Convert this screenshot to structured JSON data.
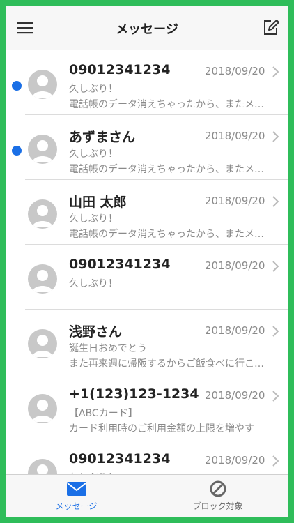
{
  "header": {
    "title": "メッセージ",
    "menu_icon": "hamburger-menu-icon",
    "compose_icon": "compose-icon"
  },
  "messages": [
    {
      "name": "09012341234",
      "date": "2018/09/20",
      "line1": "久しぶり！",
      "line2": "電話帳のデータ消えちゃったから、またメ…",
      "unread": true
    },
    {
      "name": "あずまさん",
      "date": "2018/09/20",
      "line1": "久しぶり！",
      "line2": "電話帳のデータ消えちゃったから、またメ…",
      "unread": true
    },
    {
      "name": "山田 太郎",
      "date": "2018/09/20",
      "line1": "久しぶり！",
      "line2": "電話帳のデータ消えちゃったから、またメ…",
      "unread": false
    },
    {
      "name": "09012341234",
      "date": "2018/09/20",
      "line1": "久しぶり！",
      "line2": "",
      "unread": false
    },
    {
      "name": "浅野さん",
      "date": "2018/09/20",
      "line1": "誕生日おめでとう",
      "line2": "また再来週に帰阪するからご飯食べに行こ…",
      "unread": false
    },
    {
      "name": "+1(123)123-1234",
      "date": "2018/09/20",
      "line1": "【ABCカード】",
      "line2": "カード利用時のご利用金額の上限を増やす",
      "unread": false
    },
    {
      "name": "09012341234",
      "date": "2018/09/20",
      "line1": "久しぶり！",
      "line2": "",
      "unread": false
    }
  ],
  "tabs": [
    {
      "label": "メッセージ",
      "icon": "envelope-icon",
      "active": true
    },
    {
      "label": "ブロック対象",
      "icon": "block-icon",
      "active": false
    }
  ],
  "colors": {
    "background": "#2fbd5a",
    "accent": "#1a6fe6",
    "inactive": "#666666"
  }
}
